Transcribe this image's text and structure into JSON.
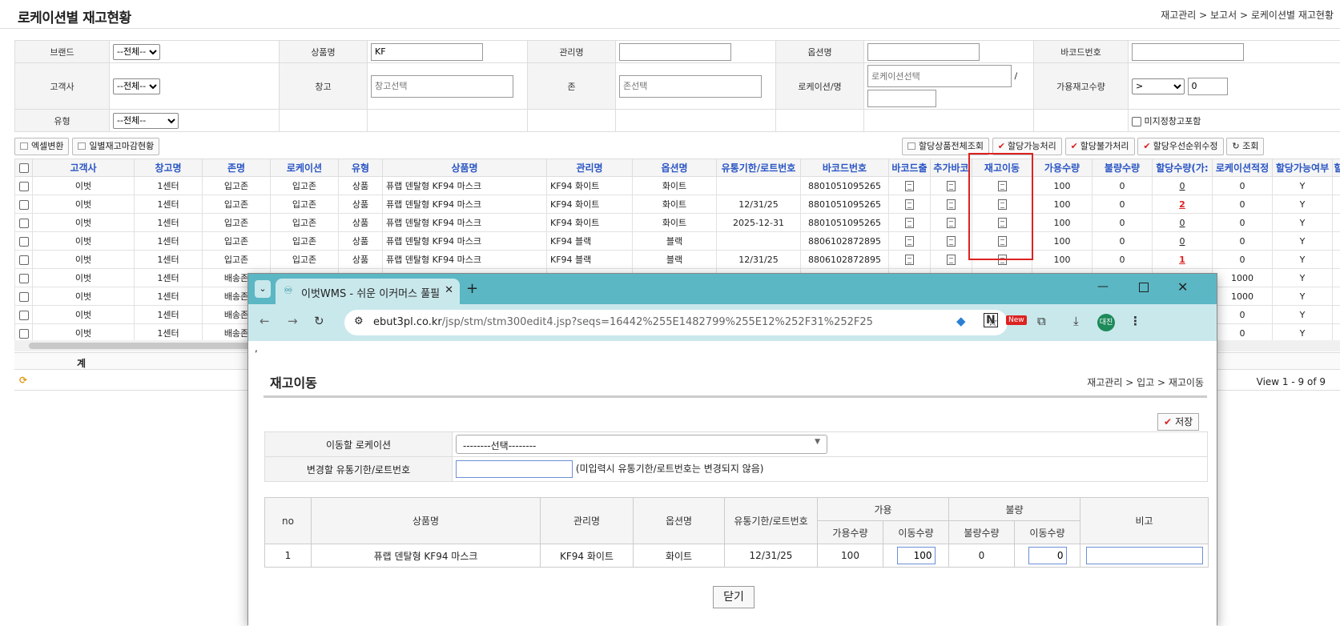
{
  "header": {
    "title": "로케이션별 재고현황",
    "breadcrumb": "재고관리 > 보고서 > 로케이션별 재고현황"
  },
  "filters": {
    "brand_label": "브랜드",
    "brand_value": "--전체--",
    "product_label": "상품명",
    "product_value": "KF",
    "mgmt_label": "관리명",
    "option_label": "옵션명",
    "barcode_label": "바코드번호",
    "customer_label": "고객사",
    "customer_value": "--전체--",
    "warehouse_label": "창고",
    "warehouse_placeholder": "창고선택",
    "zone_label": "존",
    "zone_placeholder": "존선택",
    "location_label": "로케이션/명",
    "location_placeholder": "로케이션선택",
    "slash": "/",
    "avail_label": "가용재고수량",
    "avail_op": ">",
    "avail_value": "0",
    "type_label": "유형",
    "type_value": "--전체--",
    "unassigned_label": "미지정창고포함"
  },
  "toolbar": {
    "excel": "엑셀변환",
    "daily": "일별재고마감현황",
    "alloc_all": "할당상품전체조회",
    "alloc_ok": "할당가능처리",
    "alloc_no": "할당불가처리",
    "alloc_priority": "할당우선순위수정",
    "search": "조회"
  },
  "grid": {
    "columns": [
      "고객사",
      "창고명",
      "존명",
      "로케이션",
      "유형",
      "상품명",
      "관리명",
      "옵션명",
      "유통기한/로트번호",
      "바코드번호",
      "바코드출",
      "추가바코",
      "재고이동",
      "가용수량",
      "불량수량",
      "할당수량(가:",
      "로케이션적정",
      "할당가능여부",
      "할"
    ],
    "rows": [
      [
        "이벗",
        "1센터",
        "입고존",
        "입고존",
        "상품",
        "퓨랩 덴탈형 KF94 마스크",
        "KF94 화이트",
        "화이트",
        "",
        "8801051095265",
        "100",
        "0",
        "0",
        "0",
        "Y"
      ],
      [
        "이벗",
        "1센터",
        "입고존",
        "입고존",
        "상품",
        "퓨랩 덴탈형 KF94 마스크",
        "KF94 화이트",
        "화이트",
        "12/31/25",
        "8801051095265",
        "100",
        "0",
        "2",
        "0",
        "Y"
      ],
      [
        "이벗",
        "1센터",
        "입고존",
        "입고존",
        "상품",
        "퓨랩 덴탈형 KF94 마스크",
        "KF94 화이트",
        "화이트",
        "2025-12-31",
        "8801051095265",
        "100",
        "0",
        "0",
        "0",
        "Y"
      ],
      [
        "이벗",
        "1센터",
        "입고존",
        "입고존",
        "상품",
        "퓨랩 덴탈형 KF94 마스크",
        "KF94 블랙",
        "블랙",
        "",
        "8806102872895",
        "100",
        "0",
        "0",
        "0",
        "Y"
      ],
      [
        "이벗",
        "1센터",
        "입고존",
        "입고존",
        "상품",
        "퓨랩 덴탈형 KF94 마스크",
        "KF94 블랙",
        "블랙",
        "12/31/25",
        "8806102872895",
        "100",
        "0",
        "1",
        "0",
        "Y"
      ],
      [
        "이벗",
        "1센터",
        "배송존",
        "",
        "",
        "",
        "",
        "",
        "",
        "",
        "",
        "",
        "",
        "1000",
        "Y"
      ],
      [
        "이벗",
        "1센터",
        "배송존",
        "",
        "",
        "",
        "",
        "",
        "",
        "",
        "",
        "",
        "",
        "1000",
        "Y"
      ],
      [
        "이벗",
        "1센터",
        "배송존",
        "",
        "",
        "",
        "",
        "",
        "",
        "",
        "",
        "",
        "",
        "0",
        "Y"
      ],
      [
        "이벗",
        "1센터",
        "배송존",
        "",
        "",
        "",
        "",
        "",
        "",
        "",
        "",
        "",
        "",
        "0",
        "Y"
      ]
    ],
    "total_label": "계",
    "view_text": "View 1 - 9 of 9"
  },
  "browser": {
    "tab_title": "이벗WMS - 쉬운 이커머스 풀필",
    "url_host": "ebut3pl.co.kr",
    "url_path": "/jsp/stm/stm300edit4.jsp?seqs=16442%255E1482799%255E12%252F31%252F25",
    "new_badge": "New",
    "avatar": "대진"
  },
  "modal": {
    "stray": ",",
    "title": "재고이동",
    "breadcrumb": "재고관리 > 입고 > 재고이동",
    "save": "저장",
    "move_loc_label": "이동할 로케이션",
    "move_loc_value": "--------선택--------",
    "expiry_label": "변경할 유통기한/로트번호",
    "expiry_note": "(미입력시 유통기한/로트번호는 변경되지 않음)",
    "headers": {
      "no": "no",
      "product": "상품명",
      "mgmt": "관리명",
      "option": "옵션명",
      "expiry": "유통기한/로트번호",
      "avail_group": "가용",
      "defect_group": "불량",
      "avail_qty": "가용수량",
      "move_qty": "이동수량",
      "defect_qty": "불량수량",
      "defect_move": "이동수량",
      "note": "비고"
    },
    "row": {
      "no": "1",
      "product": "퓨랩 덴탈형 KF94 마스크",
      "mgmt": "KF94 화이트",
      "option": "화이트",
      "expiry": "12/31/25",
      "avail": "100",
      "move": "100",
      "defect": "0",
      "defect_move": "0"
    },
    "close": "닫기"
  }
}
